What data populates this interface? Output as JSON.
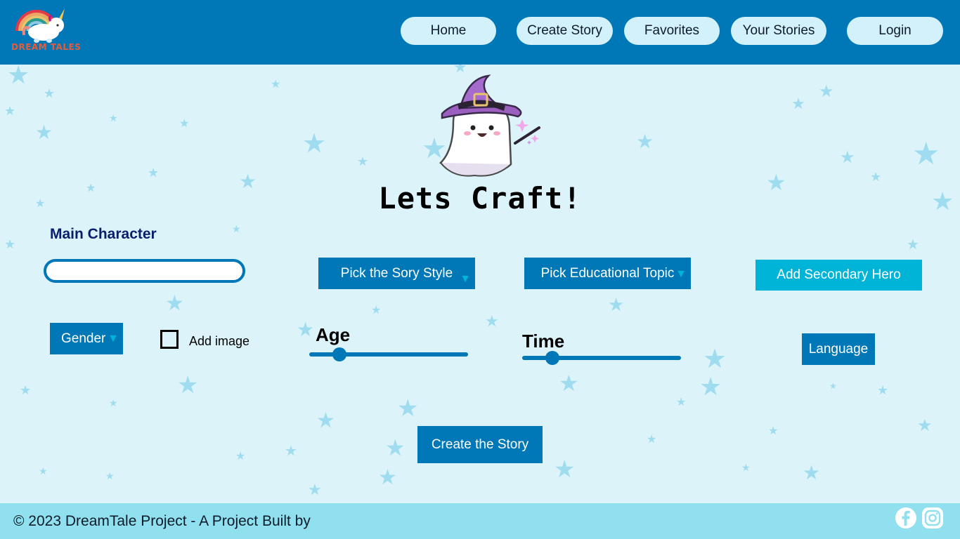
{
  "brand": {
    "logo_text": "DREAM TALES"
  },
  "nav": {
    "home": "Home",
    "create_story": "Create Story",
    "favorites": "Favorites",
    "your_stories": "Your Stories",
    "login": "Login"
  },
  "main": {
    "title": "Lets Craft!",
    "main_character_label": "Main Character",
    "main_character_value": "",
    "story_style_button": "Pick the Sory Style",
    "educational_topic_button": "Pick Educational Topic",
    "secondary_hero_button": "Add Secondary Hero",
    "gender_button": "Gender",
    "add_image_label": "Add image",
    "add_image_checked": false,
    "age_label": "Age",
    "age_slider_fraction": 0.19,
    "time_label": "Time",
    "time_slider_fraction": 0.19,
    "language_button": "Language",
    "create_button": "Create the Story"
  },
  "footer": {
    "copyright": "© 2023 DreamTale Project - A Project Built by",
    "social": [
      "facebook-icon",
      "instagram-icon"
    ]
  },
  "colors": {
    "header_bg": "#0077b6",
    "page_bg": "#dbf3f9",
    "nav_pill": "#d3f1fa",
    "button_blue": "#0077b6",
    "button_cyan": "#00b4d8",
    "footer_bg": "#90e0ef"
  },
  "icons": [
    "unicorn-logo-icon",
    "ghost-wizard-icon",
    "chevron-down-icon",
    "facebook-icon",
    "instagram-icon"
  ]
}
